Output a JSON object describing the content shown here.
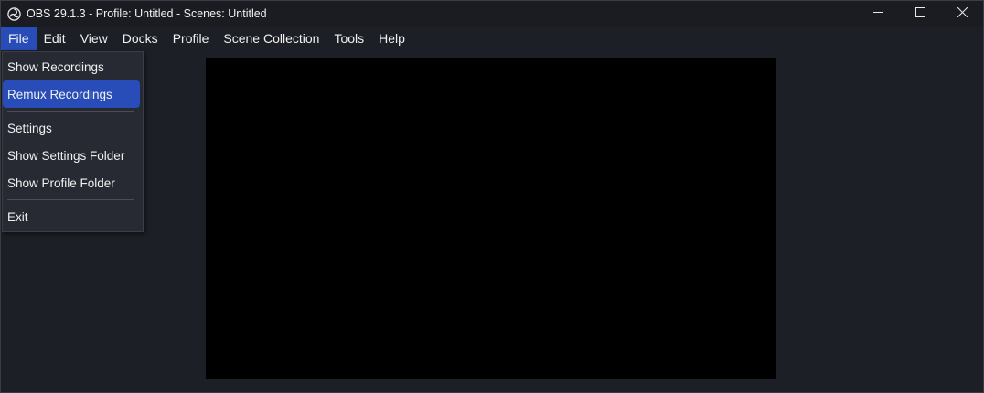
{
  "window": {
    "title": "OBS 29.1.3 - Profile: Untitled - Scenes: Untitled",
    "app_icon": "obs-logo-icon",
    "controls": [
      "minimize-icon",
      "maximize-icon",
      "close-icon"
    ]
  },
  "menubar": {
    "items": [
      {
        "label": "File",
        "active": true
      },
      {
        "label": "Edit"
      },
      {
        "label": "View"
      },
      {
        "label": "Docks"
      },
      {
        "label": "Profile"
      },
      {
        "label": "Scene Collection"
      },
      {
        "label": "Tools"
      },
      {
        "label": "Help"
      }
    ]
  },
  "file_menu": {
    "show_recordings": "Show Recordings",
    "remux_recordings": "Remux Recordings",
    "settings": "Settings",
    "show_settings_folder": "Show Settings Folder",
    "show_profile_folder": "Show Profile Folder",
    "exit": "Exit"
  },
  "colors": {
    "accent": "#284cb8",
    "background": "#1d1f26",
    "preview": "#000000"
  }
}
